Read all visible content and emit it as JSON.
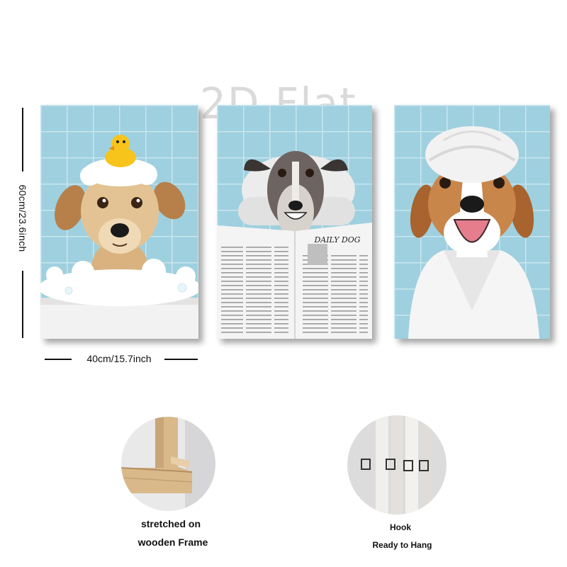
{
  "watermark": "2D Flat",
  "dimensions": {
    "height_label": "60cm/23.6inch",
    "width_label": "40cm/15.7inch"
  },
  "panels": [
    {
      "name": "dog-in-bubble-bath",
      "newspaper_title": ""
    },
    {
      "name": "dog-reading-newspaper",
      "newspaper_title": "DAILY DOG"
    },
    {
      "name": "dog-in-towel-and-robe",
      "newspaper_title": ""
    }
  ],
  "features": [
    {
      "icon": "wooden-frame-icon",
      "lines": [
        "stretched on",
        "wooden Frame"
      ]
    },
    {
      "icon": "hook-icon",
      "lines": [
        "Hook",
        "Ready to Hang"
      ]
    }
  ],
  "colors": {
    "tile_blue": "#9fd0df",
    "grout": "#c9e6ee",
    "wood": "#d9b98a"
  }
}
